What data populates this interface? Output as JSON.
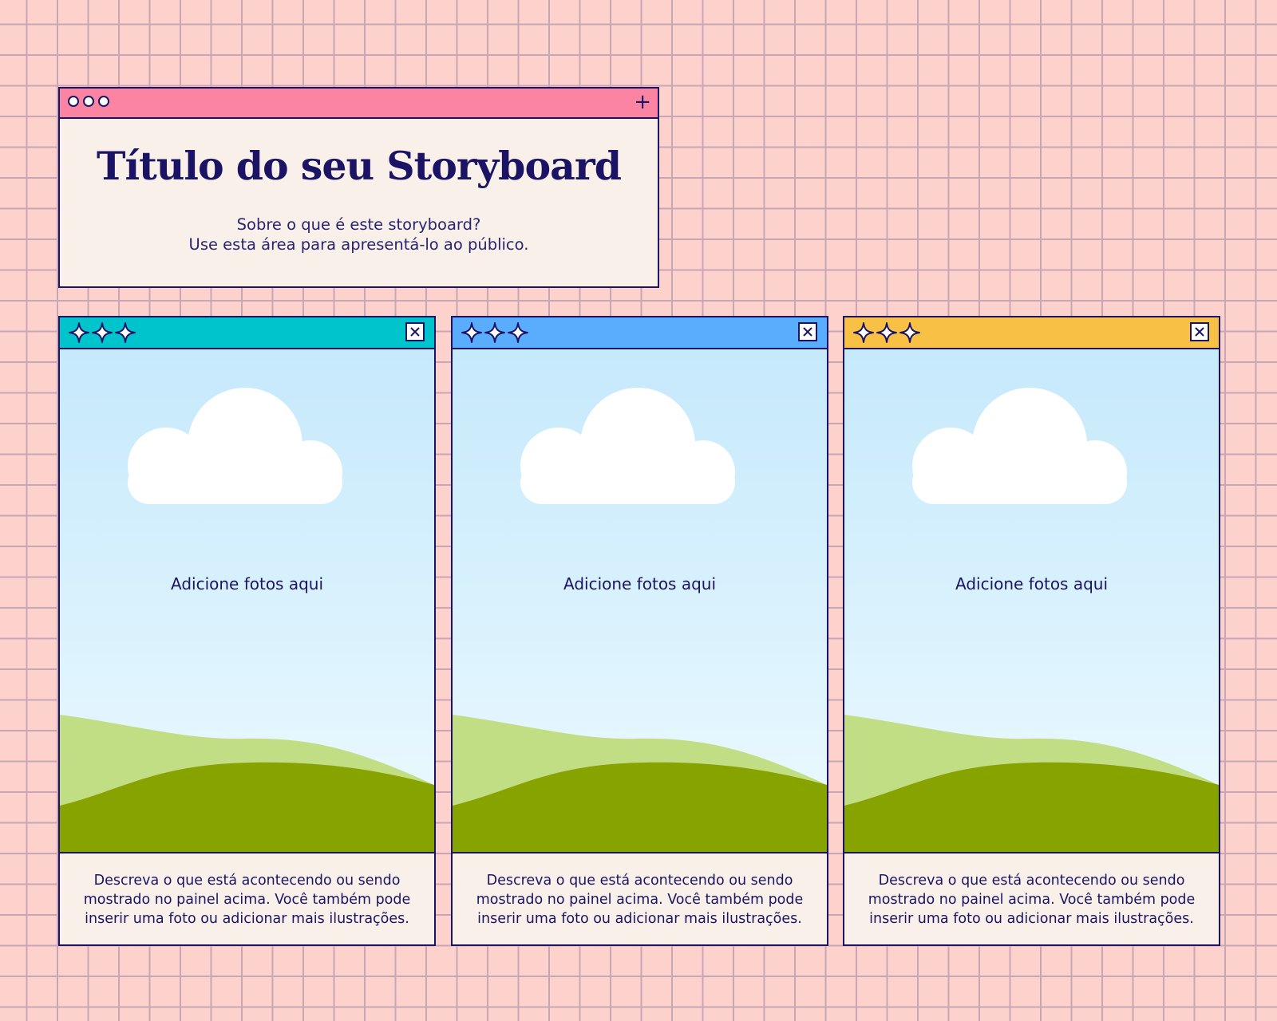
{
  "title_window": {
    "title": "Título do seu Storyboard",
    "subtitle_lines": [
      "Sobre o que é este storyboard?",
      "Use esta área para apresentá-lo ao público."
    ],
    "bar_color": "#fa84a2",
    "icons": [
      "circle-icon",
      "circle-icon",
      "circle-icon",
      "plus-icon"
    ]
  },
  "panels": [
    {
      "bar_color": "#00c4cb",
      "placeholder": "Adicione fotos aqui",
      "caption_lines": [
        "Descreva o que está acontecendo ou sendo",
        "mostrado no painel acima. Você também pode",
        "inserir uma foto ou adicionar mais ilustrações."
      ],
      "icons": [
        "sparkle-icon",
        "sparkle-icon",
        "sparkle-icon",
        "close-icon"
      ]
    },
    {
      "bar_color": "#5aadfd",
      "placeholder": "Adicione fotos aqui",
      "caption_lines": [
        "Descreva o que está acontecendo ou sendo",
        "mostrado no painel acima. Você também pode",
        "inserir uma foto ou adicionar mais ilustrações."
      ],
      "icons": [
        "sparkle-icon",
        "sparkle-icon",
        "sparkle-icon",
        "close-icon"
      ]
    },
    {
      "bar_color": "#f8c146",
      "placeholder": "Adicione fotos aqui",
      "caption_lines": [
        "Descreva o que está acontecendo ou sendo",
        "mostrado no painel acima. Você também pode",
        "inserir uma foto ou adicionar mais ilustrações."
      ],
      "icons": [
        "sparkle-icon",
        "sparkle-icon",
        "sparkle-icon",
        "close-icon"
      ]
    }
  ],
  "colors": {
    "background": "#fdd1cc",
    "grid": "#c9a6b6",
    "outline": "#1b1464",
    "card": "#faf0ea",
    "hill_light": "#c2de85",
    "hill_dark": "#87a300"
  }
}
